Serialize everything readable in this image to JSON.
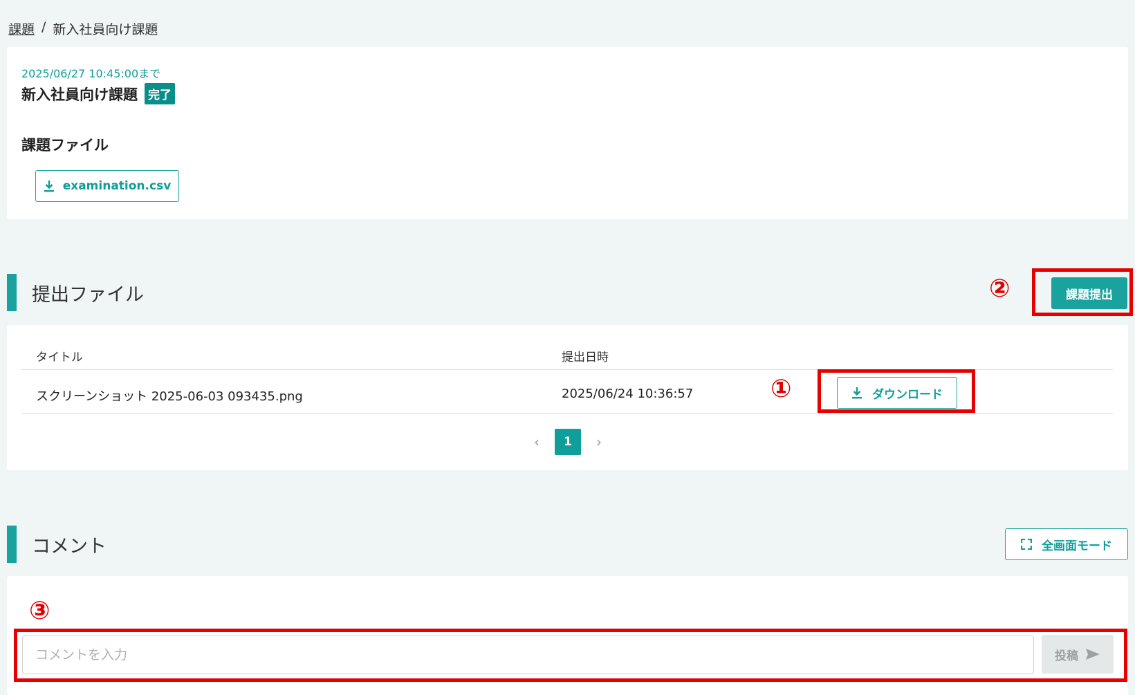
{
  "breadcrumb": {
    "link": "課題",
    "separator": "/",
    "current": "新入社員向け課題"
  },
  "task": {
    "due": "2025/06/27 10:45:00まで",
    "title": "新入社員向け課題",
    "status_badge": "完了",
    "file_heading": "課題ファイル",
    "file_name": "examination.csv"
  },
  "submission": {
    "heading": "提出ファイル",
    "submit_button": "課題提出",
    "columns": {
      "title": "タイトル",
      "date": "提出日時"
    },
    "rows": [
      {
        "title": "スクリーンショット 2025-06-03 093435.png",
        "date": "2025/06/24 10:36:57",
        "download_label": "ダウンロード"
      }
    ],
    "pager": {
      "prev": "‹",
      "current": "1",
      "next": "›"
    }
  },
  "comments": {
    "heading": "コメント",
    "fullscreen_button": "全画面モード",
    "input_placeholder": "コメントを入力",
    "post_button": "投稿"
  },
  "annotations": {
    "one": "①",
    "two": "②",
    "three": "③"
  },
  "colors": {
    "accent": "#1aa39e",
    "badge": "#0a8e89",
    "annotation_red": "#e60000"
  }
}
